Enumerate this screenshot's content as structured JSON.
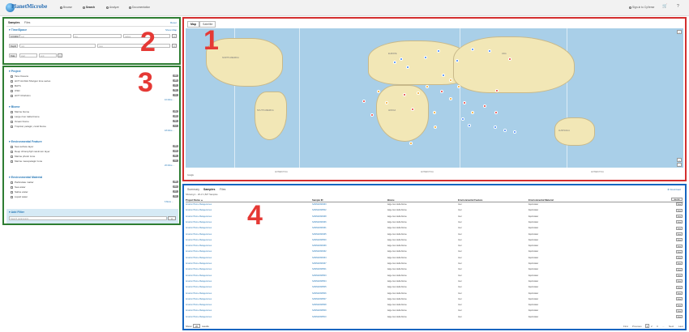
{
  "nav": {
    "brand": "PlanetMicrobe",
    "items": [
      {
        "label": "Browse",
        "icon": "compass-icon"
      },
      {
        "label": "Search",
        "icon": "search-icon"
      },
      {
        "label": "Analyze",
        "icon": "chart-icon"
      },
      {
        "label": "Documentation",
        "icon": "book-icon"
      }
    ],
    "signin": "Sign-in to CyVerse"
  },
  "search_panel": {
    "tabs": [
      "Samples",
      "Files"
    ],
    "reset": "Reset",
    "timespace": {
      "title": "Time/Space",
      "show_map": "Show Map",
      "location_label": "Location",
      "location_mode": "Lat",
      "lat_placeholder": "Lat",
      "lng_placeholder": "lng",
      "radius_placeholder": "radius",
      "depth_label": "Depth",
      "depth_min": "min",
      "depth_max": "max",
      "date_label": "Date",
      "date_start": "start",
      "date_end": "end"
    }
  },
  "facets": [
    {
      "title": "Project",
      "items": [
        {
          "label": "Tara Oceans",
          "count": "240"
        },
        {
          "label": "HOT ALOHA Shotgun time series",
          "count": "165"
        },
        {
          "label": "BATS",
          "count": "78"
        },
        {
          "label": "OSD",
          "count": "50"
        },
        {
          "label": "HOT Chisholm",
          "count": "31"
        }
      ],
      "more": "10 More ..."
    },
    {
      "title": "Biome",
      "items": [
        {
          "label": "Marine biome",
          "count": "432"
        },
        {
          "label": "Large river delta biome",
          "count": "120"
        },
        {
          "label": "Ocean biome",
          "count": "58"
        },
        {
          "label": "Tropical, pelagic, coral biome",
          "count": "12"
        }
      ],
      "more": "18 More ..."
    },
    {
      "title": "Environmental Feature",
      "items": [
        {
          "label": "Sea surface layer",
          "count": "368"
        },
        {
          "label": "Deep chlorophyll maximum layer",
          "count": "118"
        },
        {
          "label": "Marine photic zone",
          "count": "65"
        },
        {
          "label": "Marine mesopelagic zone",
          "count": "41"
        }
      ],
      "more": "20 More ..."
    },
    {
      "title": "Environmental Material",
      "items": [
        {
          "label": "Particulate matter",
          "count": "365"
        },
        {
          "label": "Sea water",
          "count": "214"
        },
        {
          "label": "Saline water",
          "count": "97"
        },
        {
          "label": "Liquid water",
          "count": "64"
        }
      ],
      "more": "6 More ..."
    }
  ],
  "add_filter": {
    "title": "Add Filter",
    "placeholder": "Search parameters"
  },
  "map": {
    "tabs": [
      "Map",
      "Satellite"
    ],
    "continents": [
      "NORTH AMERICA",
      "SOUTH AMERICA",
      "EUROPE",
      "AFRICA",
      "ASIA",
      "AUSTRALIA",
      "ANTARCTICA",
      "ANTARCTICA",
      "ANTARCTICA"
    ],
    "attribution": "Google",
    "marker_colors": {
      "blue": "#3b82f6",
      "orange": "#f5a623",
      "red": "#e53935"
    }
  },
  "results": {
    "tabs": [
      "Summary",
      "Samples",
      "Files"
    ],
    "download": "Download",
    "showing": "Showing 1 - 20 of 1,827 Samples",
    "add": "Add All",
    "columns": [
      "Project Name ▲",
      "Sample ID",
      "Biome",
      "Environmental Feature",
      "Environmental Material"
    ],
    "rows": [
      {
        "project": "Amazon Plume Metagenomes",
        "sample": "SAMN02628493",
        "biome": "large river delta biome",
        "feature": "river",
        "material": "liquid water"
      },
      {
        "project": "Amazon Plume Metagenomes",
        "sample": "SAMN02628502",
        "biome": "large river delta biome",
        "feature": "river",
        "material": "liquid water"
      },
      {
        "project": "Amazon Plume Metagenomes",
        "sample": "SAMN02628498",
        "biome": "large river delta biome",
        "feature": "river",
        "material": "liquid water"
      },
      {
        "project": "Amazon Plume Metagenomes",
        "sample": "SAMN02628496",
        "biome": "large river delta biome",
        "feature": "river",
        "material": "liquid water"
      },
      {
        "project": "Amazon Plume Metagenomes",
        "sample": "SAMN02628491",
        "biome": "large river delta biome",
        "feature": "river",
        "material": "liquid water"
      },
      {
        "project": "Amazon Plume Metagenomes",
        "sample": "SAMN02628495",
        "biome": "large river delta biome",
        "feature": "river",
        "material": "liquid water"
      },
      {
        "project": "Amazon Plume Metagenomes",
        "sample": "SAMN02628500",
        "biome": "large river delta biome",
        "feature": "river",
        "material": "liquid water"
      },
      {
        "project": "Amazon Plume Metagenomes",
        "sample": "SAMN02628499",
        "biome": "large river delta biome",
        "feature": "river",
        "material": "liquid water"
      },
      {
        "project": "Amazon Plume Metagenomes",
        "sample": "SAMN02628492",
        "biome": "large river delta biome",
        "feature": "river",
        "material": "liquid water"
      },
      {
        "project": "Amazon Plume Metagenomes",
        "sample": "SAMN02628494",
        "biome": "large river delta biome",
        "feature": "river",
        "material": "liquid water"
      },
      {
        "project": "Amazon Plume Metagenomes",
        "sample": "SAMN02628497",
        "biome": "large river delta biome",
        "feature": "river",
        "material": "liquid water"
      },
      {
        "project": "Amazon Plume Metagenomes",
        "sample": "SAMN02628501",
        "biome": "large river delta biome",
        "feature": "river",
        "material": "liquid water"
      },
      {
        "project": "Amazon Plume Metagenomes",
        "sample": "SAMN02628503",
        "biome": "large river delta biome",
        "feature": "river",
        "material": "liquid water"
      },
      {
        "project": "Amazon Plume Metagenomes",
        "sample": "SAMN02628504",
        "biome": "large river delta biome",
        "feature": "river",
        "material": "liquid water"
      },
      {
        "project": "Amazon Plume Metagenomes",
        "sample": "SAMN02628505",
        "biome": "large river delta biome",
        "feature": "river",
        "material": "liquid water"
      },
      {
        "project": "Amazon Plume Metagenomes",
        "sample": "SAMN02628506",
        "biome": "large river delta biome",
        "feature": "river",
        "material": "liquid water"
      },
      {
        "project": "Amazon Plume Metagenomes",
        "sample": "SAMN02628507",
        "biome": "large river delta biome",
        "feature": "river",
        "material": "liquid water"
      },
      {
        "project": "Amazon Plume Metagenomes",
        "sample": "SAMN02628508",
        "biome": "large river delta biome",
        "feature": "river",
        "material": "liquid water"
      },
      {
        "project": "Amazon Plume Metagenomes",
        "sample": "SAMN02628509",
        "biome": "large river delta biome",
        "feature": "river",
        "material": "liquid water"
      },
      {
        "project": "Amazon Plume Metagenomes",
        "sample": "SAMN02628510",
        "biome": "large river delta biome",
        "feature": "river",
        "material": "liquid water"
      }
    ],
    "row_button": "View",
    "show_label": "Show",
    "show_value": "20",
    "results_label": "results",
    "pagination": [
      "First",
      "Previous",
      "1",
      "2",
      "3",
      "...",
      "Next",
      "Last"
    ]
  },
  "annotations": [
    "1",
    "2",
    "3",
    "4"
  ]
}
